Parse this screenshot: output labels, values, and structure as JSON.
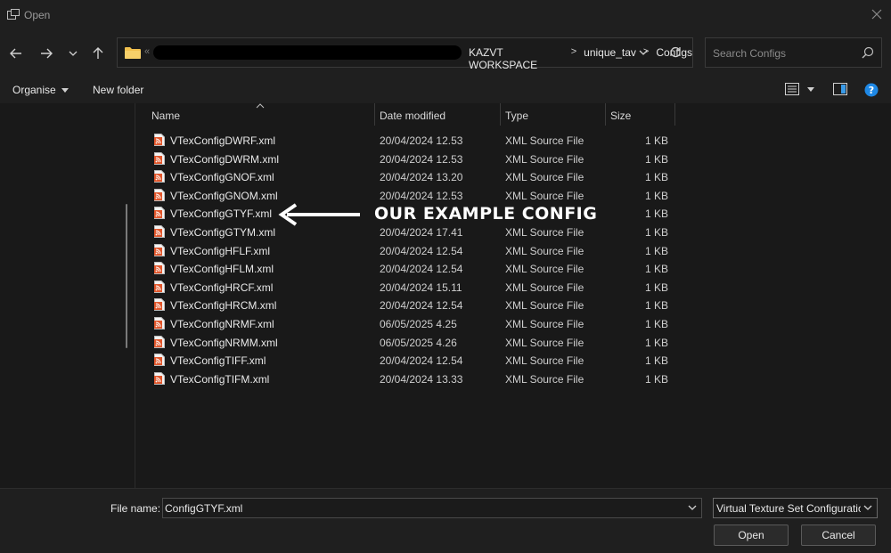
{
  "window": {
    "title": "Open"
  },
  "address": {
    "crumbs": [
      "KAZVT WORKSPACE",
      "unique_tav",
      "Configs"
    ],
    "overflow": "«"
  },
  "search": {
    "placeholder": "Search Configs"
  },
  "toolbar": {
    "organise": "Organise",
    "new_folder": "New folder"
  },
  "columns": {
    "name": "Name",
    "date": "Date modified",
    "type": "Type",
    "size": "Size"
  },
  "files": [
    {
      "name": "VTexConfigDWRF.xml",
      "date": "20/04/2024 12.53",
      "type": "XML Source File",
      "size": "1 KB"
    },
    {
      "name": "VTexConfigDWRM.xml",
      "date": "20/04/2024 12.53",
      "type": "XML Source File",
      "size": "1 KB"
    },
    {
      "name": "VTexConfigGNOF.xml",
      "date": "20/04/2024 13.20",
      "type": "XML Source File",
      "size": "1 KB"
    },
    {
      "name": "VTexConfigGNOM.xml",
      "date": "20/04/2024 12.53",
      "type": "XML Source File",
      "size": "1 KB"
    },
    {
      "name": "VTexConfigGTYF.xml",
      "date": "",
      "type": "",
      "size": "1 KB"
    },
    {
      "name": "VTexConfigGTYM.xml",
      "date": "20/04/2024 17.41",
      "type": "XML Source File",
      "size": "1 KB"
    },
    {
      "name": "VTexConfigHFLF.xml",
      "date": "20/04/2024 12.54",
      "type": "XML Source File",
      "size": "1 KB"
    },
    {
      "name": "VTexConfigHFLM.xml",
      "date": "20/04/2024 12.54",
      "type": "XML Source File",
      "size": "1 KB"
    },
    {
      "name": "VTexConfigHRCF.xml",
      "date": "20/04/2024 15.11",
      "type": "XML Source File",
      "size": "1 KB"
    },
    {
      "name": "VTexConfigHRCM.xml",
      "date": "20/04/2024 12.54",
      "type": "XML Source File",
      "size": "1 KB"
    },
    {
      "name": "VTexConfigNRMF.xml",
      "date": "06/05/2025 4.25",
      "type": "XML Source File",
      "size": "1 KB"
    },
    {
      "name": "VTexConfigNRMM.xml",
      "date": "06/05/2025 4.26",
      "type": "XML Source File",
      "size": "1 KB"
    },
    {
      "name": "VTexConfigTIFF.xml",
      "date": "20/04/2024 12.54",
      "type": "XML Source File",
      "size": "1 KB"
    },
    {
      "name": "VTexConfigTIFM.xml",
      "date": "20/04/2024 13.33",
      "type": "XML Source File",
      "size": "1 KB"
    }
  ],
  "annotation": {
    "text": "OUR EXAMPLE CONFIG"
  },
  "footer": {
    "file_name_label": "File name:",
    "file_name_value": "ConfigGTYF.xml",
    "file_type": "Virtual Texture Set Configuratio",
    "open": "Open",
    "cancel": "Cancel"
  },
  "colors": {
    "background": "#191919",
    "chrome": "#1f1f1f",
    "xml_icon": "#e2572c",
    "folder": "#f2c14e",
    "help": "#1e88e5"
  },
  "icons": [
    "app-icon",
    "close-icon",
    "back-arrow-icon",
    "forward-arrow-icon",
    "chevron-down-icon",
    "up-arrow-icon",
    "folder-icon",
    "refresh-icon",
    "search-icon",
    "view-list-icon",
    "preview-pane-icon",
    "help-icon",
    "xml-file-icon",
    "left-arrow-annotation-icon"
  ]
}
